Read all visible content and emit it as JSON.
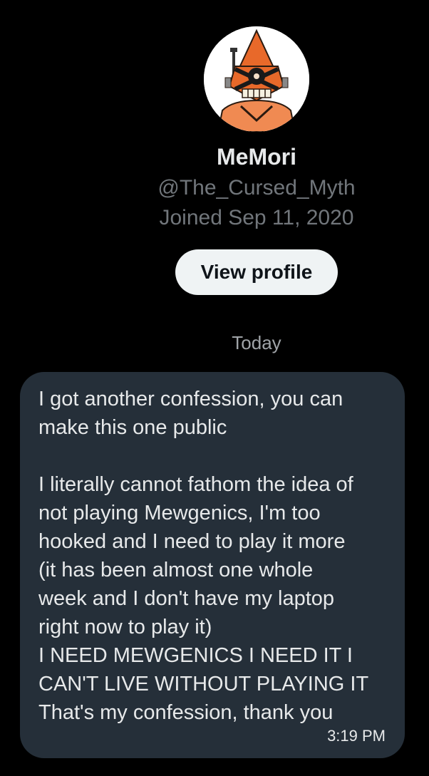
{
  "profile": {
    "display_name": "MeMori",
    "handle": "@The_Cursed_Myth",
    "joined": "Joined Sep 11, 2020",
    "view_profile_label": "View profile",
    "avatar_icon": "robot-avatar-icon"
  },
  "conversation": {
    "day_label": "Today",
    "messages": [
      {
        "text": "I got another confession, you can\nmake this one public\n\nI literally cannot fathom the idea of\nnot playing Mewgenics, I'm too\nhooked and I need to play it more\n(it has been almost one whole\nweek and I don't have my laptop\nright now to play it)\nI NEED MEWGENICS I NEED IT I\nCAN'T LIVE WITHOUT PLAYING IT\nThat's my confession, thank you",
        "time": "3:19 PM"
      }
    ]
  },
  "colors": {
    "background": "#000000",
    "bubble": "#252f39",
    "button_bg": "#eff3f4",
    "secondary_text": "#71767b",
    "avatar_orange": "#e8692a"
  }
}
